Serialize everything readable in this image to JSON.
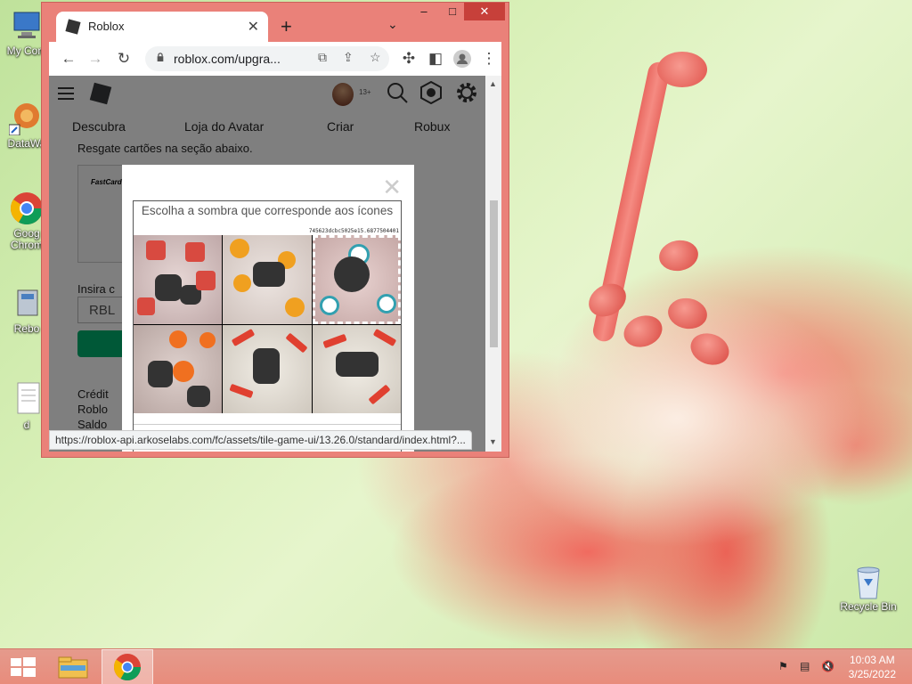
{
  "desktop": {
    "icons": [
      {
        "label": "My Com"
      },
      {
        "label": "DataWa"
      },
      {
        "label": "Goog Chrom"
      },
      {
        "label": "Rebo"
      },
      {
        "label": "d"
      },
      {
        "label": "Recycle Bin"
      }
    ]
  },
  "browser": {
    "tab_title": "Roblox",
    "url": "roblox.com/upgra...",
    "window_controls": {
      "minimize": "–",
      "maximize": "□",
      "close": "✕"
    },
    "status_url": "https://roblox-api.arkoselabs.com/fc/assets/tile-game-ui/13.26.0/standard/index.html?..."
  },
  "roblox": {
    "age_badge": "13+",
    "nav": [
      "Descubra",
      "Loja do Avatar",
      "Criar",
      "Robux"
    ],
    "redeem_text": "Resgate cartões na seção abaixo.",
    "card_brand": "FastCard",
    "insira_label": "Insira c",
    "code_value": "RBL",
    "credits_lines": [
      "Crédit",
      "Roblo",
      "Saldo"
    ]
  },
  "captcha": {
    "prompt": "Escolha a sombra que corresponde aos ícones",
    "token": "745623dcbc5025e15.6877504401",
    "tiles": [
      {
        "theme": "bags",
        "selected": false
      },
      {
        "theme": "flowers",
        "selected": false
      },
      {
        "theme": "rings",
        "selected": true
      },
      {
        "theme": "flowers",
        "selected": false
      },
      {
        "theme": "pencils",
        "selected": false
      },
      {
        "theme": "pencils",
        "selected": false
      }
    ]
  },
  "taskbar": {
    "time": "10:03 AM",
    "date": "3/25/2022"
  }
}
